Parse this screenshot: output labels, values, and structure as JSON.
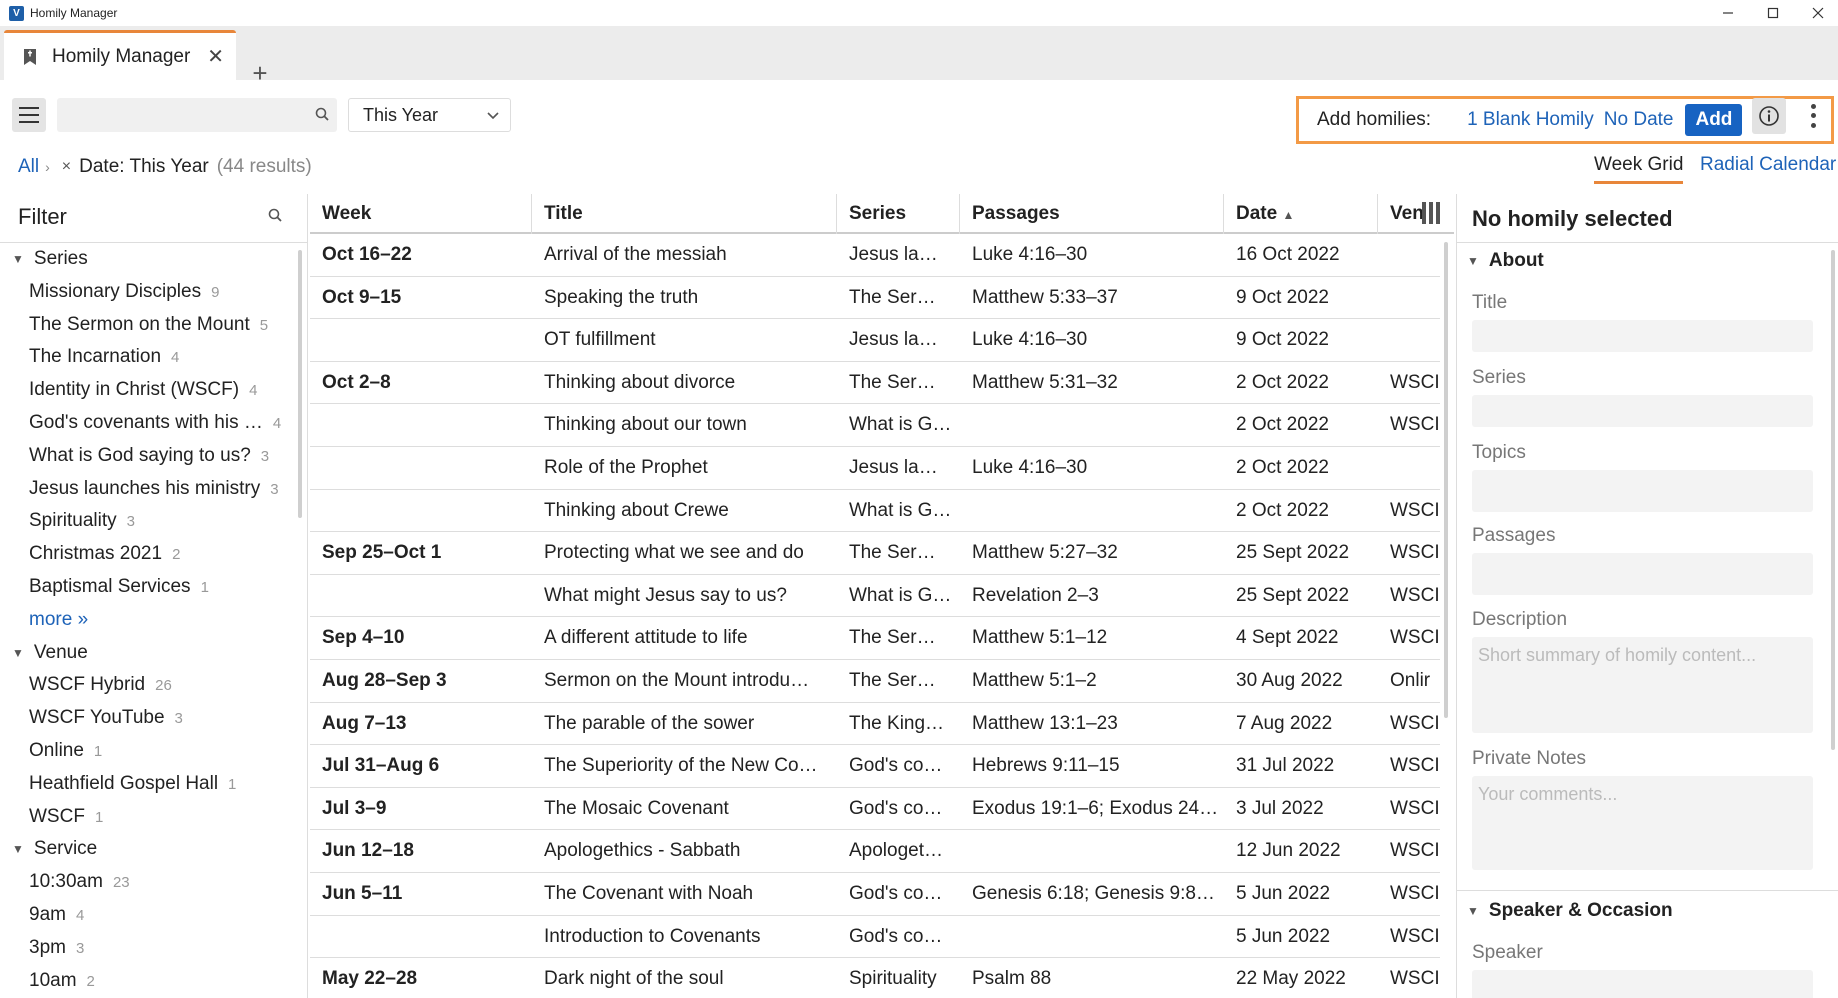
{
  "window": {
    "title": "Homily Manager",
    "logo": "V"
  },
  "tab": {
    "label": "Homily Manager",
    "close": "✕",
    "new": "+"
  },
  "toolbar": {
    "search_value": "",
    "search_placeholder": "",
    "year_select": "This Year",
    "add_label": "Add homilies:",
    "add_option_1": "1 Blank Homily",
    "add_option_2": "No Date",
    "add_button": "Add"
  },
  "breadcrumb": {
    "all": "All",
    "sep": "›",
    "remove": "×",
    "filter": "Date: This Year",
    "results": "(44 results)"
  },
  "views": {
    "week_grid": "Week Grid",
    "radial": "Radial Calendar"
  },
  "filter": {
    "title": "Filter",
    "groups": [
      {
        "label": "Series",
        "items": [
          {
            "label": "Missionary Disciples",
            "count": "9"
          },
          {
            "label": "The Sermon on the Mount",
            "count": "5"
          },
          {
            "label": "The Incarnation",
            "count": "4"
          },
          {
            "label": "Identity in Christ (WSCF)",
            "count": "4"
          },
          {
            "label": "God's covenants with his …",
            "count": "4"
          },
          {
            "label": "What is God saying to us?",
            "count": "3"
          },
          {
            "label": "Jesus launches his ministry",
            "count": "3"
          },
          {
            "label": "Spirituality",
            "count": "3"
          },
          {
            "label": "Christmas 2021",
            "count": "2"
          },
          {
            "label": "Baptismal Services",
            "count": "1"
          }
        ],
        "more": "more »"
      },
      {
        "label": "Venue",
        "items": [
          {
            "label": "WSCF Hybrid",
            "count": "26"
          },
          {
            "label": "WSCF YouTube",
            "count": "3"
          },
          {
            "label": "Online",
            "count": "1"
          },
          {
            "label": "Heathfield Gospel Hall",
            "count": "1"
          },
          {
            "label": "WSCF",
            "count": "1"
          }
        ]
      },
      {
        "label": "Service",
        "items": [
          {
            "label": "10:30am",
            "count": "23"
          },
          {
            "label": "9am",
            "count": "4"
          },
          {
            "label": "3pm",
            "count": "3"
          },
          {
            "label": "10am",
            "count": "2"
          }
        ]
      }
    ]
  },
  "grid": {
    "columns": {
      "week": "Week",
      "title": "Title",
      "series": "Series",
      "passages": "Passages",
      "date": "Date",
      "sort": "▲",
      "venue": "Venue"
    },
    "rows": [
      {
        "week": "Oct 16–22",
        "title": "Arrival of the messiah",
        "series": "Jesus la…",
        "passages": "Luke 4:16–30",
        "date": "16 Oct 2022",
        "venue": ""
      },
      {
        "week": "Oct 9–15",
        "title": "Speaking the truth",
        "series": "The Ser…",
        "passages": "Matthew 5:33–37",
        "date": "9 Oct 2022",
        "venue": ""
      },
      {
        "week": "",
        "title": "OT fulfillment",
        "series": "Jesus la…",
        "passages": "Luke 4:16–30",
        "date": "9 Oct 2022",
        "venue": ""
      },
      {
        "week": "Oct 2–8",
        "title": "Thinking about divorce",
        "series": "The Ser…",
        "passages": "Matthew 5:31–32",
        "date": "2 Oct 2022",
        "venue": "WSCI"
      },
      {
        "week": "",
        "title": "Thinking about our town",
        "series": "What is G…",
        "passages": "",
        "date": "2 Oct 2022",
        "venue": "WSCI"
      },
      {
        "week": "",
        "title": "Role of the Prophet",
        "series": "Jesus la…",
        "passages": "Luke 4:16–30",
        "date": "2 Oct 2022",
        "venue": ""
      },
      {
        "week": "",
        "title": "Thinking about Crewe",
        "series": "What is G…",
        "passages": "",
        "date": "2 Oct 2022",
        "venue": "WSCI"
      },
      {
        "week": "Sep 25–Oct 1",
        "title": "Protecting what we see and do",
        "series": "The Ser…",
        "passages": "Matthew 5:27–32",
        "date": "25 Sept 2022",
        "venue": "WSCI"
      },
      {
        "week": "",
        "title": "What might Jesus say to us?",
        "series": "What is G…",
        "passages": "Revelation 2–3",
        "date": "25 Sept 2022",
        "venue": "WSCI"
      },
      {
        "week": "Sep 4–10",
        "title": "A different attitude to life",
        "series": "The Ser…",
        "passages": "Matthew 5:1–12",
        "date": "4 Sept 2022",
        "venue": "WSCI"
      },
      {
        "week": "Aug 28–Sep 3",
        "title": "Sermon on the Mount introdu…",
        "series": "The Ser…",
        "passages": "Matthew 5:1–2",
        "date": "30 Aug 2022",
        "venue": "Onlir"
      },
      {
        "week": "Aug 7–13",
        "title": "The parable of the sower",
        "series": "The King…",
        "passages": "Matthew 13:1–23",
        "date": "7 Aug 2022",
        "venue": "WSCI"
      },
      {
        "week": "Jul 31–Aug 6",
        "title": "The Superiority of the New Co…",
        "series": "God's co…",
        "passages": "Hebrews 9:11–15",
        "date": "31 Jul 2022",
        "venue": "WSCI"
      },
      {
        "week": "Jul 3–9",
        "title": "The Mosaic Covenant",
        "series": "God's co…",
        "passages": "Exodus 19:1–6; Exodus 24…",
        "date": "3 Jul 2022",
        "venue": "WSCI"
      },
      {
        "week": "Jun 12–18",
        "title": "Apologethics - Sabbath",
        "series": "Apologet…",
        "passages": "",
        "date": "12 Jun 2022",
        "venue": "WSCI"
      },
      {
        "week": "Jun 5–11",
        "title": "The Covenant with Noah",
        "series": "God's co…",
        "passages": "Genesis 6:18; Genesis 9:8…",
        "date": "5 Jun 2022",
        "venue": "WSCI"
      },
      {
        "week": "",
        "title": "Introduction to Covenants",
        "series": "God's co…",
        "passages": "",
        "date": "5 Jun 2022",
        "venue": "WSCI"
      },
      {
        "week": "May 22–28",
        "title": "Dark night of the soul",
        "series": "Spirituality",
        "passages": "Psalm 88",
        "date": "22 May 2022",
        "venue": "WSCI"
      }
    ]
  },
  "detail": {
    "heading": "No homily selected",
    "about": "About",
    "title_label": "Title",
    "series_label": "Series",
    "topics_label": "Topics",
    "passages_label": "Passages",
    "description_label": "Description",
    "description_placeholder": "Short summary of homily content...",
    "notes_label": "Private Notes",
    "notes_placeholder": "Your comments...",
    "speaker_section": "Speaker & Occasion",
    "speaker_label": "Speaker"
  },
  "icons": {
    "menu": "hamburger-icon",
    "search": "search-icon",
    "info": "info-icon",
    "more": "kebab-icon",
    "columns": "column-picker-icon"
  },
  "colors": {
    "accent": "#e8863a",
    "link": "#1e63b8",
    "button": "#1763c2",
    "highlight_border": "#f39a46"
  }
}
